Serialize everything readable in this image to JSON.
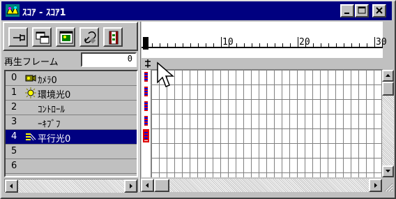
{
  "window": {
    "title": "ｽｺｱ - ｽｺｱ1",
    "controls": [
      "minimize",
      "maximize",
      "close"
    ],
    "accent": "#000080"
  },
  "toolbar": {
    "tools": [
      {
        "icon": "pin-icon"
      },
      {
        "icon": "windows-icon"
      },
      {
        "icon": "picture-icon"
      },
      {
        "icon": "link-icon"
      },
      {
        "icon": "film-icon"
      }
    ]
  },
  "frame_field": {
    "label": "再生フレーム",
    "value": "0"
  },
  "objects": [
    {
      "num": "0",
      "icon": "camera-icon",
      "name": "ｶﾒﾗ0"
    },
    {
      "num": "1",
      "icon": "ambient-light-icon",
      "name": "環境光0"
    },
    {
      "num": "2",
      "icon": "",
      "name": "ｺﾝﾄﾛｰﾙ"
    },
    {
      "num": "3",
      "icon": "",
      "name": "ｰｷﾌﾞﾌ"
    },
    {
      "num": "4",
      "icon": "parallel-light-icon",
      "name": "平行光0"
    },
    {
      "num": "5",
      "icon": "",
      "name": ""
    },
    {
      "num": "6",
      "icon": "",
      "name": ""
    }
  ],
  "selected_index": 4,
  "timeline": {
    "ruler_labels": [
      "0",
      "10",
      "20",
      "30"
    ],
    "current_frame": 0,
    "keyframe_rows": [
      0,
      1,
      2,
      3,
      4
    ],
    "selected_keyframe_row": 4,
    "key_colors": [
      "#e00000",
      "#0000e0"
    ]
  }
}
